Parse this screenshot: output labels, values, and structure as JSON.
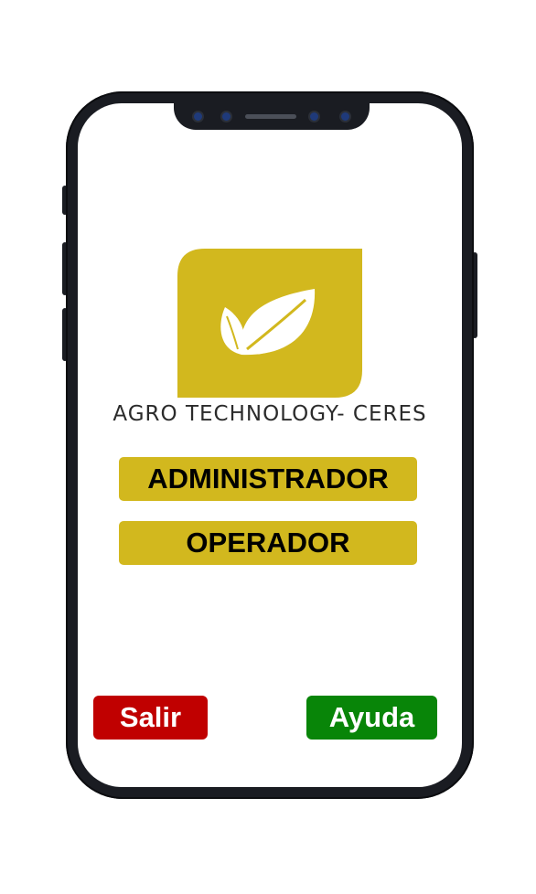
{
  "brand": {
    "name": "AGRO TECHNOLOGY- CERES",
    "logo_icon": "leaf-sprout-icon",
    "logo_color": "#d2b81e"
  },
  "roles": {
    "admin_label": "ADMINISTRADOR",
    "operator_label": "OPERADOR"
  },
  "actions": {
    "exit_label": "Salir",
    "exit_color": "#c00000",
    "help_label": "Ayuda",
    "help_color": "#088508"
  }
}
